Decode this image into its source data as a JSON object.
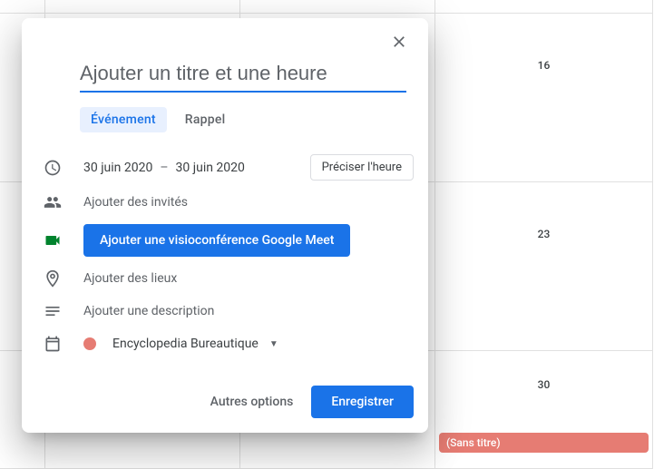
{
  "calendar": {
    "dates": {
      "d16": "16",
      "d23": "23",
      "d30": "30"
    },
    "untitled_event": "(Sans titre)"
  },
  "dialog": {
    "title_placeholder": "Ajouter un titre et une heure",
    "tabs": {
      "event": "Événement",
      "reminder": "Rappel"
    },
    "date_start": "30 juin 2020",
    "date_sep": "–",
    "date_end": "30 juin 2020",
    "specify_time": "Préciser l'heure",
    "add_guests": "Ajouter des invités",
    "add_meet": "Ajouter une visioconférence Google Meet",
    "add_location": "Ajouter des lieux",
    "add_description": "Ajouter une description",
    "calendar_name": "Encyclopedia Bureautique",
    "more_options": "Autres options",
    "save": "Enregistrer"
  }
}
